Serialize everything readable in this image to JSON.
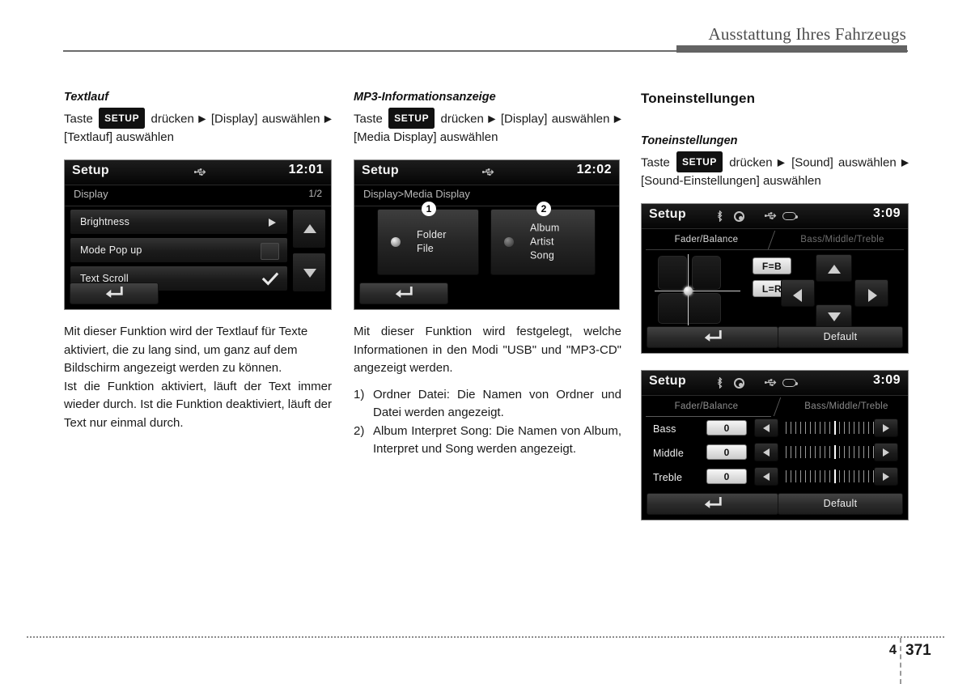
{
  "header": {
    "title": "Ausstattung Ihres Fahrzeugs"
  },
  "footer": {
    "chapter": "4",
    "page": "371"
  },
  "column1": {
    "subtitle": "Textlauf",
    "path_pre": "Taste",
    "setup_chip": "SETUP",
    "path_mid": "drücken",
    "path_item1": "[Display]",
    "path_select1": "auswählen",
    "path_item2": "[Textlauf]",
    "path_select2": "auswählen",
    "screen": {
      "title": "Setup",
      "clock": "12:01",
      "usb_icon": "usb-icon",
      "subheader": "Display",
      "page_indicator": "1/2",
      "rows": [
        {
          "label": "Brightness",
          "control": "arrow"
        },
        {
          "label": "Mode Pop up",
          "control": "checkbox-empty"
        },
        {
          "label": "Text Scroll",
          "control": "checkbox-checked"
        }
      ],
      "scroll_up": "up-arrow",
      "scroll_down": "down-arrow",
      "back": "back-icon"
    },
    "paragraph1": "Mit dieser Funktion wird der Textlauf für Texte aktiviert, die zu lang sind, um ganz auf dem Bildschirm angezeigt werden zu können.",
    "paragraph2": "Ist die Funktion aktiviert, läuft der Text immer wieder durch. Ist die Funktion deaktiviert, läuft der Text nur einmal durch."
  },
  "column2": {
    "subtitle": "MP3-Informationsanzeige",
    "path_pre": "Taste",
    "setup_chip": "SETUP",
    "path_mid": "drücken",
    "path_item1": "[Display]",
    "path_select1": "auswählen",
    "path_item2": "[Media Display]",
    "path_select2": "auswählen",
    "screen": {
      "title": "Setup",
      "clock": "12:02",
      "usb_icon": "usb-icon",
      "subheader": "Display>Media Display",
      "options": [
        {
          "marker": "❶",
          "number": "1",
          "lines": "Folder\nFile",
          "line1": "Folder",
          "line2": "File",
          "selected": true
        },
        {
          "marker": "❷",
          "number": "2",
          "lines": "Album\nArtist\nSong",
          "line1": "Album",
          "line2": "Artist",
          "line3": "Song",
          "selected": false
        }
      ],
      "back": "back-icon"
    },
    "paragraph1": "Mit dieser Funktion wird festgelegt, welche Informationen in den Modi \"USB\" und \"MP3-CD\" angezeigt werden.",
    "list": [
      {
        "num": "1)",
        "text": "Ordner Datei: Die Namen von Ordner und Datei werden angezeigt."
      },
      {
        "num": "2)",
        "text": "Album Interpret Song: Die Namen von Album, Interpret und Song werden angezeigt."
      }
    ]
  },
  "column3": {
    "title": "Toneinstellungen",
    "subtitle": "Toneinstellungen",
    "path_pre": "Taste",
    "setup_chip": "SETUP",
    "path_mid": "drücken",
    "path_item1": "[Sound]",
    "path_select1": "auswählen",
    "path_item2": "[Sound-Einstellungen]",
    "path_select2": "auswählen",
    "screen_fader": {
      "title": "Setup",
      "clock": "3:09",
      "icons": [
        "bluetooth-icon",
        "cd-icon",
        "usb-icon",
        "battery-icon"
      ],
      "tab_active": "Fader/Balance",
      "tab_inactive": "Bass/Middle/Treble",
      "btn_fb": "F=B",
      "btn_lr": "L=R",
      "dpad": [
        "up-arrow",
        "left-arrow",
        "right-arrow",
        "down-arrow"
      ],
      "back": "back-icon",
      "default_label": "Default"
    },
    "screen_eq": {
      "title": "Setup",
      "clock": "3:09",
      "icons": [
        "bluetooth-icon",
        "cd-icon",
        "usb-icon",
        "battery-icon"
      ],
      "tab_inactive": "Fader/Balance",
      "tab_active": "Bass/Middle/Treble",
      "rows": [
        {
          "label": "Bass",
          "value": "0"
        },
        {
          "label": "Middle",
          "value": "0"
        },
        {
          "label": "Treble",
          "value": "0"
        }
      ],
      "back": "back-icon",
      "default_label": "Default"
    }
  }
}
